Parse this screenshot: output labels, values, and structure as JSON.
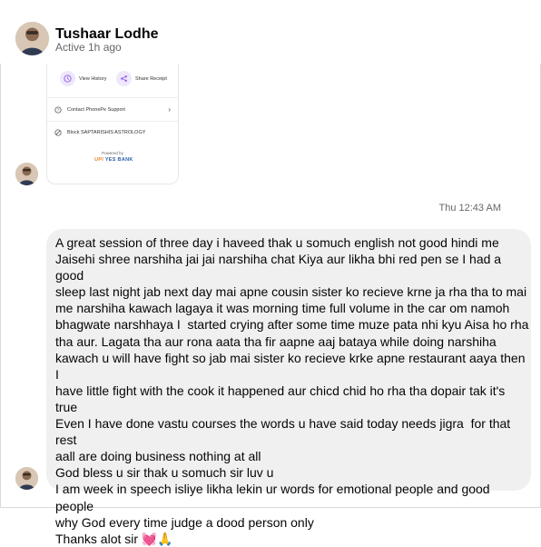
{
  "header": {
    "name": "Tushaar Lodhe",
    "status": "Active 1h ago"
  },
  "receipt": {
    "view_history_label": "View History",
    "share_receipt_label": "Share Receipt",
    "contact_support_label": "Contact PhonePe Support",
    "block_label": "Block SAPTARISHIS ASTROLOGY",
    "powered_by_label": "Powered by",
    "upi_logo": "UPI",
    "bank_logo": "YES BANK",
    "accent_color": "#8f5ce8"
  },
  "timestamp": "Thu 12:43 AM",
  "message": {
    "text": "A great session of three day i haveed thak u somuch english not good hindi me\nJaisehi shree narshiha jai jai narshiha chat Kiya aur likha bhi red pen se I had a good\nsleep last night jab next day mai apne cousin sister ko recieve krne ja rha tha to mai\nme narshiha kawach lagaya it was morning time full volume in the car om namoh\nbhagwate narshhaya I  started crying after some time muze pata nhi kyu Aisa ho rha\ntha aur. Lagata tha aur rona aata tha fir aapne aaj bataya while doing narshiha\nkawach u will have fight so jab mai sister ko recieve krke apne restaurant aaya then I\nhave little fight with the cook it happened aur chicd chid ho rha tha dopair tak it's\ntrue\nEven I have done vastu courses the words u have said today needs jigra  for that rest\naall are doing business nothing at all\nGod bless u sir thak u somuch sir luv u\nI am week in speech isliye likha lekin ur words for emotional people and good people\nwhy God every time judge a dood person only\nThanks alot sir 💓🙏",
    "bubble_color": "#f0f0f0"
  }
}
